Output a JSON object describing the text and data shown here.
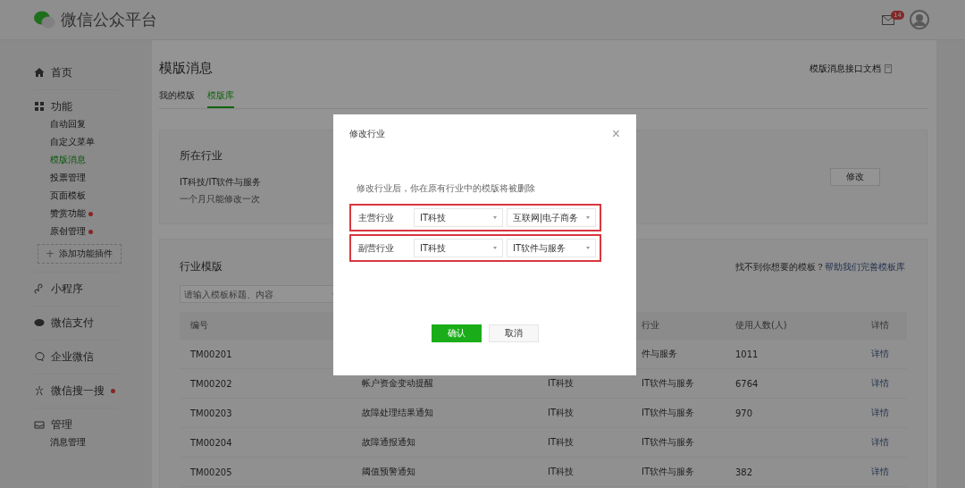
{
  "header": {
    "logo": "微信公众平台",
    "mail_badge": "14"
  },
  "sidebar": [
    {
      "label": "首页",
      "dot": false
    },
    {
      "label": "功能",
      "dot": false,
      "items": [
        {
          "label": "自动回复",
          "selected": false,
          "dot": false
        },
        {
          "label": "自定义菜单",
          "selected": false,
          "dot": false
        },
        {
          "label": "模版消息",
          "selected": true,
          "dot": false
        },
        {
          "label": "投票管理",
          "selected": false,
          "dot": false
        },
        {
          "label": "页面模板",
          "selected": false,
          "dot": false
        },
        {
          "label": "赞赏功能",
          "selected": false,
          "dot": true
        },
        {
          "label": "原创管理",
          "selected": false,
          "dot": true
        }
      ],
      "add_plugin": {
        "icon": "+",
        "label": "添加功能插件"
      }
    },
    {
      "label": "小程序",
      "dot": false
    },
    {
      "label": "微信支付",
      "dot": false
    },
    {
      "label": "企业微信",
      "dot": false
    },
    {
      "label": "微信搜一搜",
      "dot": true
    },
    {
      "label": "管理",
      "dot": false,
      "items": [
        {
          "label": "消息管理",
          "selected": false,
          "dot": false
        }
      ]
    }
  ],
  "page": {
    "title": "模版消息",
    "doc_link": "模版消息接口文档",
    "tabs": [
      {
        "label": "我的模版",
        "selected": false
      },
      {
        "label": "模版库",
        "selected": true
      }
    ],
    "industry_card": {
      "title": "所在行业",
      "value": "IT科技/IT软件与服务",
      "note": "一个月只能修改一次",
      "button": "修改"
    },
    "templates_card": {
      "title": "行业模版",
      "search": {
        "placeholder": "请输入模板标题、内容"
      },
      "hint": "找不到你想要的模板？",
      "hint_link": "帮助我们完善模板库",
      "columns": [
        "编号",
        null,
        null,
        "行业",
        "使用人数(人)",
        "详情"
      ],
      "rows": [
        {
          "id": "TM00201",
          "title": null,
          "industry1": null,
          "industry2": "件与服务",
          "count": "1011",
          "action": "详情"
        },
        {
          "id": "TM00202",
          "title": "帐户资金变动提醒",
          "industry1": "IT科技",
          "industry2": "IT软件与服务",
          "count": "6764",
          "action": "详情"
        },
        {
          "id": "TM00203",
          "title": "故障处理结果通知",
          "industry1": "IT科技",
          "industry2": "IT软件与服务",
          "count": "970",
          "action": "详情"
        },
        {
          "id": "TM00204",
          "title": "故障通报通知",
          "industry1": "IT科技",
          "industry2": "IT软件与服务",
          "count": null,
          "action": "详情"
        },
        {
          "id": "TM00205",
          "title": "阈值预警通知",
          "industry1": "IT科技",
          "industry2": "IT软件与服务",
          "count": "382",
          "action": "详情"
        }
      ]
    }
  },
  "dialog": {
    "title": "修改行业",
    "close": "×",
    "note": "修改行业后，你在原有行业中的模版将被删除",
    "rows": [
      {
        "label": "主营行业",
        "primary": "IT科技",
        "secondary": "互联网|电子商务",
        "highlighted": true
      },
      {
        "label": "副营行业",
        "primary": "IT科技",
        "secondary": "IT软件与服务",
        "highlighted": true
      }
    ],
    "confirm": "确认",
    "cancel": "取消"
  }
}
